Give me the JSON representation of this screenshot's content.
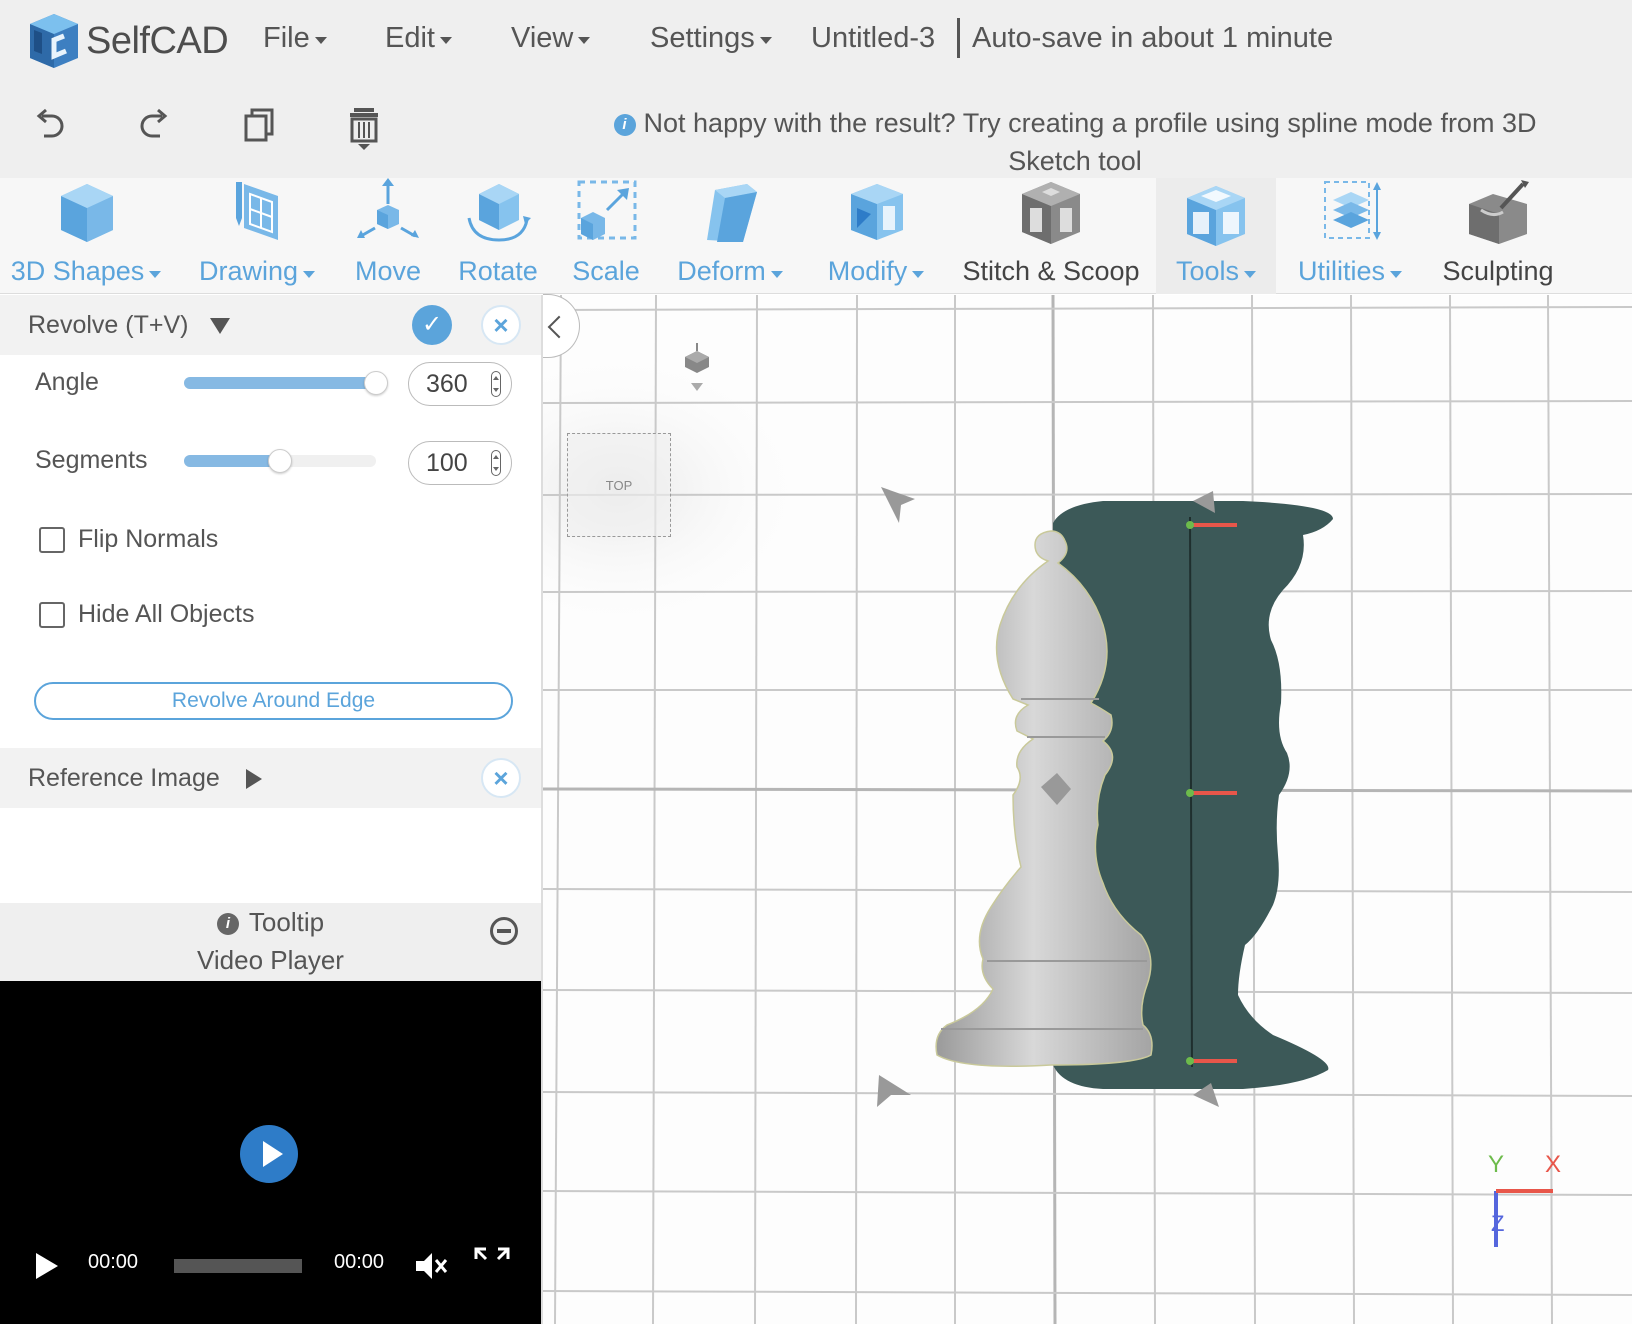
{
  "app": {
    "name": "SelfCAD"
  },
  "menu": [
    {
      "label": "File"
    },
    {
      "label": "Edit"
    },
    {
      "label": "View"
    },
    {
      "label": "Settings"
    }
  ],
  "document": {
    "name": "Untitled-3",
    "autosave": "Auto-save in about 1 minute"
  },
  "actions": [
    {
      "icon": "undo-icon"
    },
    {
      "icon": "redo-icon"
    },
    {
      "icon": "copy-icon"
    },
    {
      "icon": "delete-icon"
    }
  ],
  "hint": {
    "text": "Not happy with the result? Try creating a profile using spline mode from 3D Sketch tool"
  },
  "toolbar": [
    {
      "label": "3D Shapes",
      "dropdown": true
    },
    {
      "label": "Drawing",
      "dropdown": true
    },
    {
      "label": "Move",
      "dropdown": false
    },
    {
      "label": "Rotate",
      "dropdown": false
    },
    {
      "label": "Scale",
      "dropdown": false
    },
    {
      "label": "Deform",
      "dropdown": true
    },
    {
      "label": "Modify",
      "dropdown": true
    },
    {
      "label": "Stitch & Scoop",
      "dropdown": false
    },
    {
      "label": "Tools",
      "dropdown": true,
      "active": true
    },
    {
      "label": "Utilities",
      "dropdown": true
    },
    {
      "label": "Sculpting",
      "dropdown": false
    }
  ],
  "panel": {
    "title": "Revolve (T+V)",
    "angle": {
      "label": "Angle",
      "value": "360",
      "fraction": 1.0
    },
    "segments": {
      "label": "Segments",
      "value": "100",
      "fraction": 0.5
    },
    "flip_normals": {
      "label": "Flip Normals",
      "checked": false
    },
    "hide_all": {
      "label": "Hide All Objects",
      "checked": false
    },
    "edge_button": "Revolve Around Edge",
    "reference": {
      "title": "Reference Image"
    },
    "tooltip": {
      "title": "Tooltip",
      "subtitle": "Video Player"
    },
    "video": {
      "current": "00:00",
      "duration": "00:00"
    }
  },
  "viewport": {
    "view_label": "TOP",
    "axes": {
      "x": "X",
      "y": "Y",
      "z": "Z"
    }
  },
  "colors": {
    "accent": "#5ba4db",
    "model_dark": "#3c5958",
    "bishop": "#b9b9b9",
    "axis_x": "#e8564a",
    "axis_y": "#6dbb4b",
    "axis_z": "#5566dd"
  }
}
